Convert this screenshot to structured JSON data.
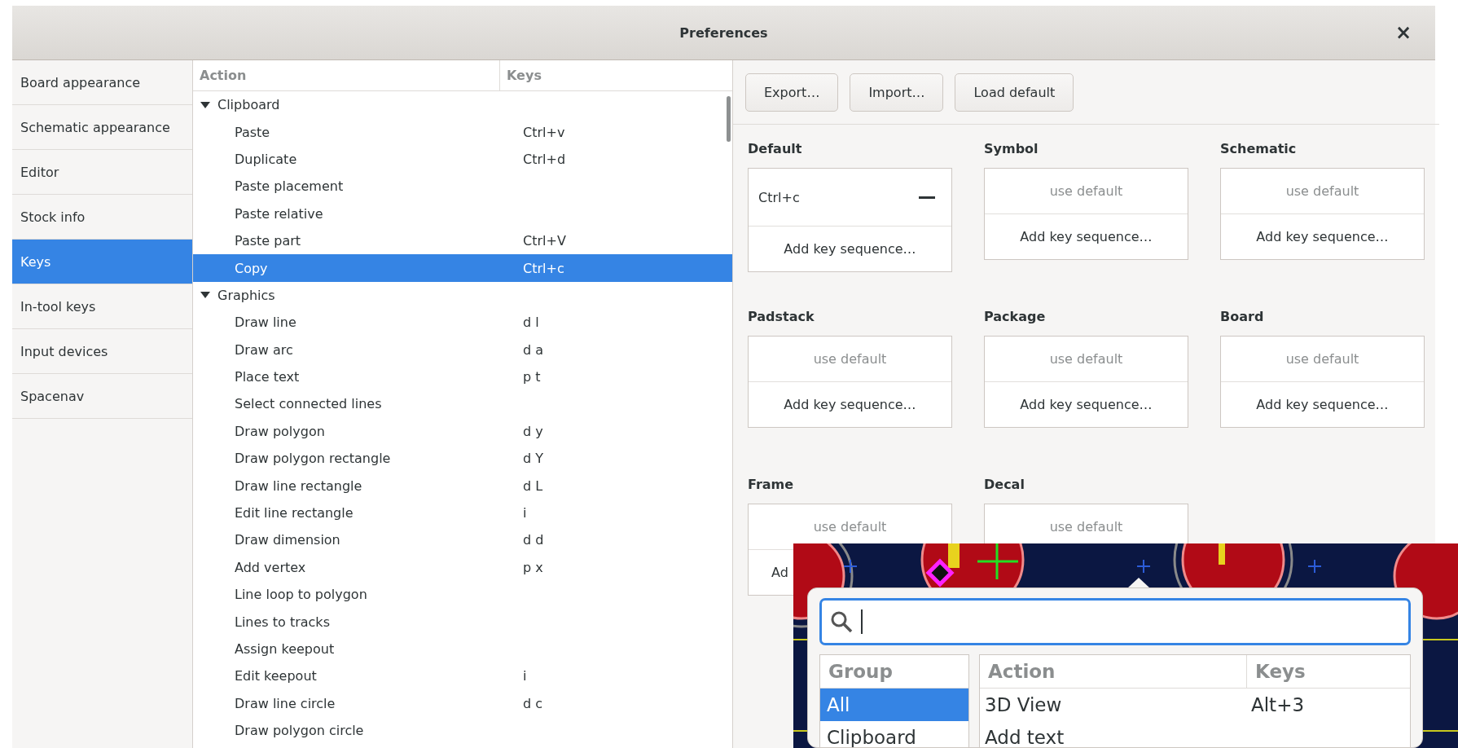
{
  "window": {
    "title": "Preferences",
    "close": "×"
  },
  "sidebar": {
    "items": [
      {
        "label": "Board appearance",
        "selected": false
      },
      {
        "label": "Schematic appearance",
        "selected": false
      },
      {
        "label": "Editor",
        "selected": false
      },
      {
        "label": "Stock info",
        "selected": false
      },
      {
        "label": "Keys",
        "selected": true
      },
      {
        "label": "In-tool keys",
        "selected": false
      },
      {
        "label": "Input devices",
        "selected": false
      },
      {
        "label": "Spacenav",
        "selected": false
      }
    ]
  },
  "tree": {
    "columns": [
      "Action",
      "Keys"
    ],
    "groups": [
      {
        "label": "Clipboard",
        "expanded": true,
        "children": [
          {
            "action": "Paste",
            "keys": "Ctrl+v",
            "selected": false
          },
          {
            "action": "Duplicate",
            "keys": "Ctrl+d",
            "selected": false
          },
          {
            "action": "Paste placement",
            "selected": false
          },
          {
            "action": "Paste relative",
            "selected": false
          },
          {
            "action": "Paste part",
            "keys": "Ctrl+V",
            "selected": false
          },
          {
            "action": "Copy",
            "keys": "Ctrl+c",
            "selected": true
          }
        ]
      },
      {
        "label": "Graphics",
        "expanded": true,
        "children": [
          {
            "action": "Draw line",
            "keys": "d l",
            "selected": false
          },
          {
            "action": "Draw arc",
            "keys": "d a",
            "selected": false
          },
          {
            "action": "Place text",
            "keys": "p t",
            "selected": false
          },
          {
            "action": "Select connected lines",
            "selected": false
          },
          {
            "action": "Draw polygon",
            "keys": "d y",
            "selected": false
          },
          {
            "action": "Draw polygon rectangle",
            "keys": "d Y",
            "selected": false
          },
          {
            "action": "Draw line rectangle",
            "keys": "d L",
            "selected": false
          },
          {
            "action": "Edit line rectangle",
            "keys": "i",
            "selected": false
          },
          {
            "action": "Draw dimension",
            "keys": "d d",
            "selected": false
          },
          {
            "action": "Add vertex",
            "keys": "p x",
            "selected": false
          },
          {
            "action": "Line loop to polygon",
            "selected": false
          },
          {
            "action": "Lines to tracks",
            "selected": false
          },
          {
            "action": "Assign keepout",
            "selected": false
          },
          {
            "action": "Edit keepout",
            "keys": "i",
            "selected": false
          },
          {
            "action": "Draw line circle",
            "keys": "d c",
            "selected": false
          },
          {
            "action": "Draw polygon circle",
            "selected": false
          }
        ]
      }
    ]
  },
  "toolbar": {
    "buttons": [
      "Export…",
      "Import…",
      "Load default"
    ]
  },
  "contexts": [
    {
      "name": "Default",
      "kind": "binding",
      "text": "Ctrl+c",
      "add_label": "Add key sequence…"
    },
    {
      "name": "Symbol",
      "kind": "default",
      "text": "use default",
      "add_label": "Add key sequence…"
    },
    {
      "name": "Schematic",
      "kind": "default",
      "text": "use default",
      "add_label": "Add key sequence…"
    },
    {
      "name": "Padstack",
      "kind": "default",
      "text": "use default",
      "add_label": "Add key sequence…"
    },
    {
      "name": "Package",
      "kind": "default",
      "text": "use default",
      "add_label": "Add key sequence…"
    },
    {
      "name": "Board",
      "kind": "default",
      "text": "use default",
      "add_label": "Add key sequence…"
    },
    {
      "name": "Frame",
      "kind": "default",
      "text": "use default",
      "add_label": "Ad"
    },
    {
      "name": "Decal",
      "kind": "default",
      "text": "use default"
    }
  ],
  "popup": {
    "groups": {
      "header": "Group",
      "items": [
        {
          "label": "All",
          "selected": true
        },
        {
          "label": "Clipboard",
          "selected": false
        }
      ]
    },
    "actions": {
      "columns": [
        "Action",
        "Keys"
      ],
      "rows": [
        {
          "action": "3D View",
          "keys": "Alt+3"
        },
        {
          "action": "Add text"
        }
      ]
    }
  }
}
